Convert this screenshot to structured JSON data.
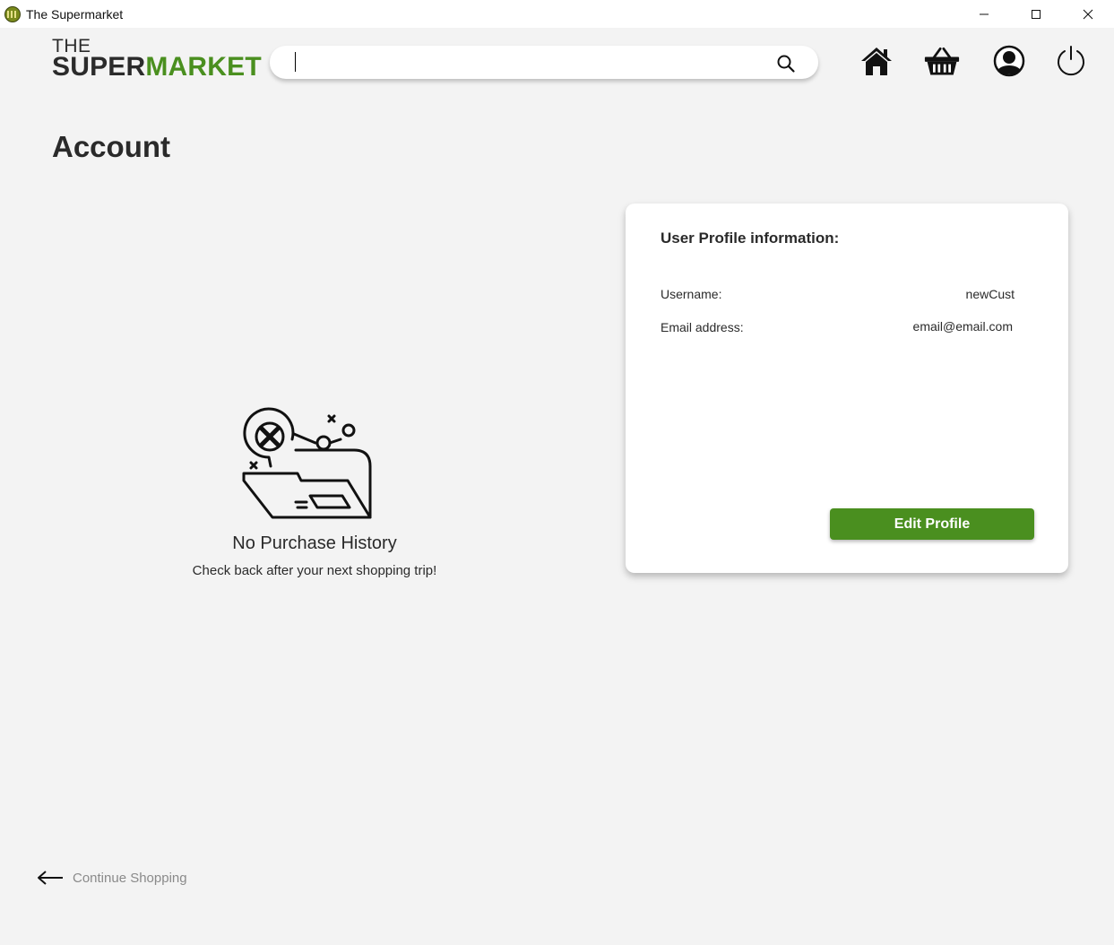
{
  "window": {
    "title": "The Supermarket"
  },
  "logo": {
    "line1": "THE",
    "line2_a": "SUPER",
    "line2_b": "MARKET"
  },
  "search": {
    "value": "",
    "placeholder": ""
  },
  "nav": {
    "icons": [
      "home-icon",
      "basket-icon",
      "account-icon",
      "power-icon"
    ]
  },
  "page": {
    "title": "Account"
  },
  "purchase_history": {
    "empty_title": "No Purchase History",
    "empty_subtitle": "Check back after your next shopping trip!"
  },
  "profile": {
    "heading": "User Profile information:",
    "username_label": "Username:",
    "username_value": "newCust",
    "email_label": "Email address:",
    "email_value": "email@email.com",
    "edit_label": "Edit Profile"
  },
  "footer": {
    "continue_label": "Continue Shopping"
  },
  "colors": {
    "brand_green": "#4a8f1f",
    "background": "#f3f3f3",
    "text": "#2a2a2a"
  }
}
